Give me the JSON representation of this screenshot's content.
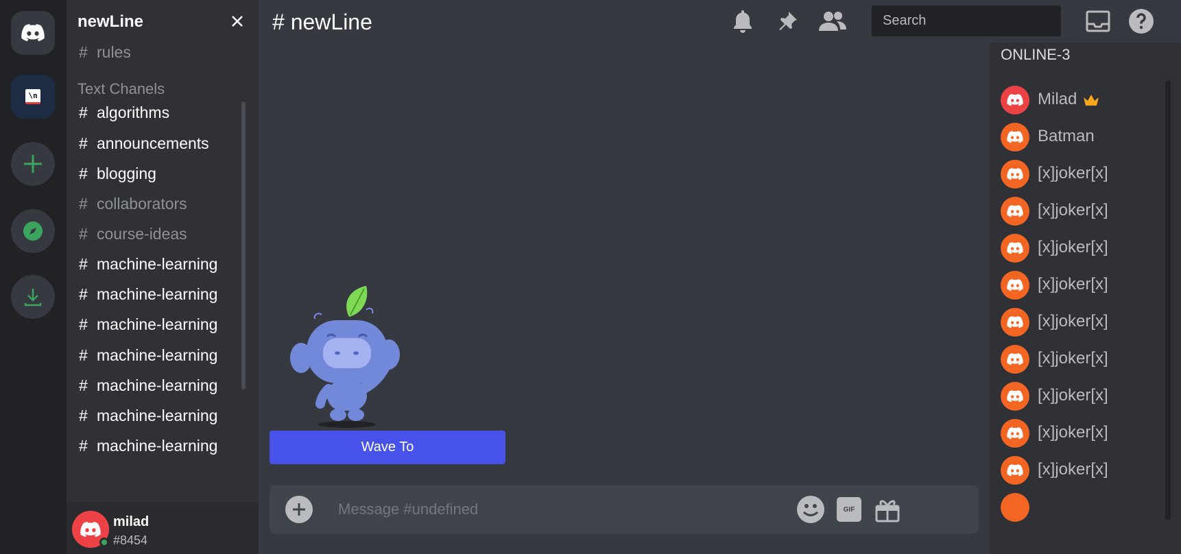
{
  "server": {
    "name": "newLine",
    "category": "Text Chanels",
    "channels": [
      {
        "name": "rules",
        "muted": true
      },
      {
        "name": "algorithms",
        "muted": false
      },
      {
        "name": "announcements",
        "muted": false
      },
      {
        "name": "blogging",
        "muted": false
      },
      {
        "name": "collaborators",
        "muted": true
      },
      {
        "name": "course-ideas",
        "muted": true
      },
      {
        "name": "machine-learning",
        "muted": false
      },
      {
        "name": "machine-learning",
        "muted": false
      },
      {
        "name": "machine-learning",
        "muted": false
      },
      {
        "name": "machine-learning",
        "muted": false
      },
      {
        "name": "machine-learning",
        "muted": false
      },
      {
        "name": "machine-learning",
        "muted": false
      },
      {
        "name": "machine-learning",
        "muted": false
      }
    ],
    "hash": "#"
  },
  "user": {
    "name": "milad",
    "tag": "#8454"
  },
  "header": {
    "title": "# newLine",
    "search_placeholder": "Search"
  },
  "chat": {
    "wave_label": "Wave To",
    "composer_placeholder": "Message #undefined",
    "gif_label": "GIF"
  },
  "members": {
    "title": "ONLINE-3",
    "list": [
      "Milad",
      "Batman",
      "[x]joker[x]",
      "[x]joker[x]",
      "[x]joker[x]",
      "[x]joker[x]",
      "[x]joker[x]",
      "[x]joker[x]",
      "[x]joker[x]",
      "[x]joker[x]",
      "[x]joker[x]"
    ]
  },
  "rail": {
    "server_badge": "\\n"
  },
  "colors": {
    "brand": "#5865f2",
    "wave_button": "#4752eb",
    "owner_avatar": "#ed4245",
    "member_avatar": "#f26522",
    "online": "#3ba55d",
    "accent_green": "#3ba55d"
  },
  "icons": [
    "discord-logo-icon",
    "add-server-icon",
    "explore-icon",
    "download-icon",
    "close-icon",
    "bell-icon",
    "pin-icon",
    "members-icon",
    "inbox-icon",
    "help-icon",
    "add-attachment-icon",
    "emoji-icon",
    "gif-icon",
    "gift-icon",
    "crown-icon"
  ]
}
